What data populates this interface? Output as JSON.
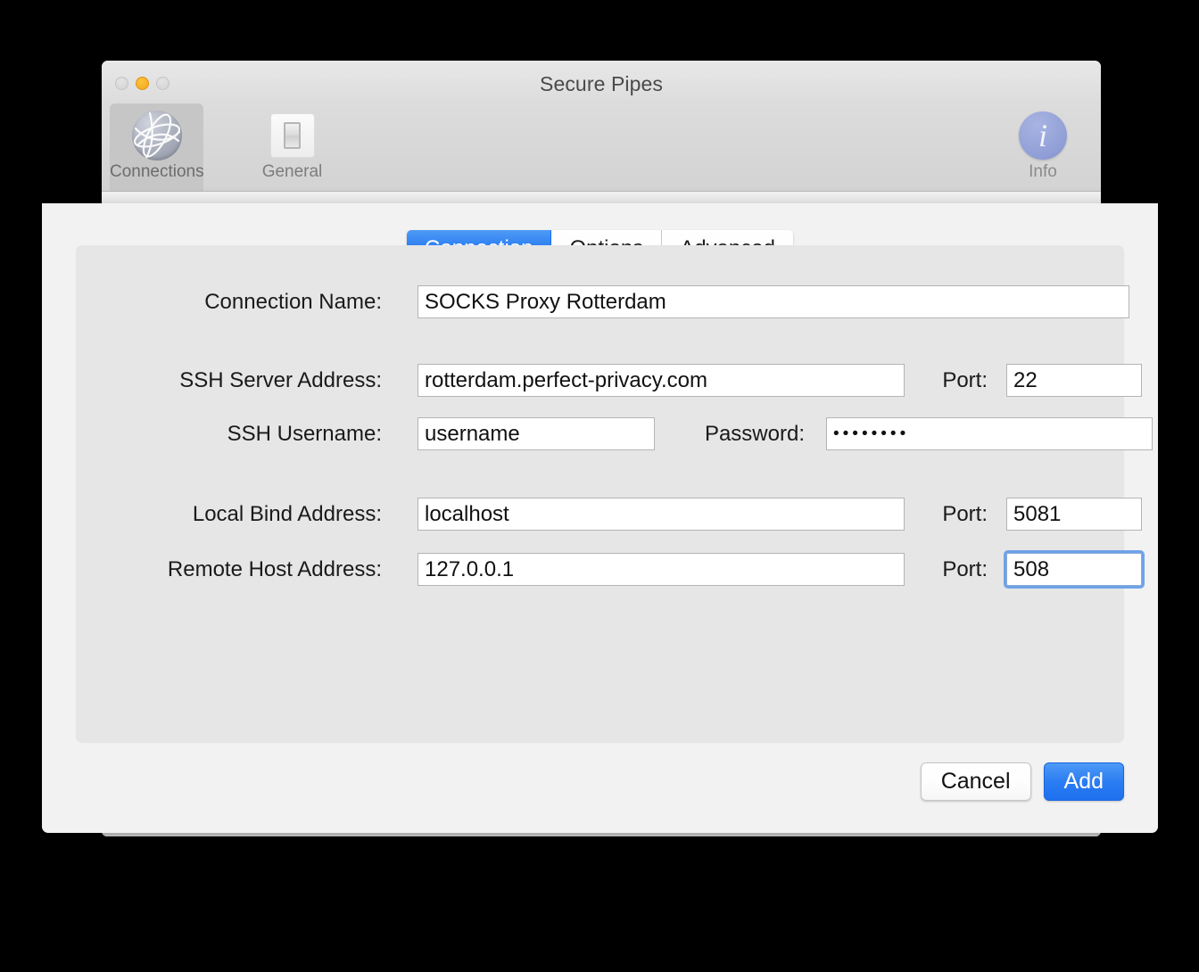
{
  "window": {
    "title": "Secure Pipes",
    "traffic_lights": [
      {
        "name": "close",
        "color": "#d2d2d2"
      },
      {
        "name": "minimize",
        "color": "#f4a71d"
      },
      {
        "name": "zoom",
        "color": "#d2d2d2"
      }
    ]
  },
  "toolbar": {
    "items": [
      {
        "label": "Connections",
        "icon": "globe-icon",
        "selected": true
      },
      {
        "label": "General",
        "icon": "light-switch-icon",
        "selected": false
      }
    ],
    "info": {
      "label": "Info",
      "icon": "info-icon",
      "glyph": "i"
    }
  },
  "sheet": {
    "tabs": [
      {
        "label": "Connection",
        "active": true
      },
      {
        "label": "Options",
        "active": false
      },
      {
        "label": "Advanced",
        "active": false
      }
    ],
    "fields": {
      "connection_name": {
        "label": "Connection Name:",
        "value": "SOCKS Proxy Rotterdam",
        "placeholder": ""
      },
      "ssh_server_address": {
        "label": "SSH Server Address:",
        "value": "rotterdam.perfect-privacy.com",
        "placeholder": ""
      },
      "ssh_server_port": {
        "label": "Port:",
        "value": "22",
        "placeholder": ""
      },
      "ssh_username": {
        "label": "SSH Username:",
        "value": "username",
        "placeholder": ""
      },
      "password": {
        "label": "Password:",
        "value": "••••••••",
        "placeholder": ""
      },
      "local_bind_address": {
        "label": "Local Bind Address:",
        "value": "localhost",
        "placeholder": ""
      },
      "local_bind_port": {
        "label": "Port:",
        "value": "5081",
        "placeholder": ""
      },
      "remote_host_address": {
        "label": "Remote Host Address:",
        "value": "127.0.0.1",
        "placeholder": ""
      },
      "remote_host_port": {
        "label": "Port:",
        "value": "508",
        "placeholder": "",
        "focused": true
      }
    },
    "buttons": {
      "cancel": "Cancel",
      "add": "Add"
    }
  },
  "colors": {
    "accent_blue": "#2b7df2",
    "focus_ring": "#5895e7",
    "window_chrome": "#dcdcdc",
    "panel": "#e6e6e6",
    "sheet": "#f2f2f2",
    "amber": "#f4a71d"
  }
}
